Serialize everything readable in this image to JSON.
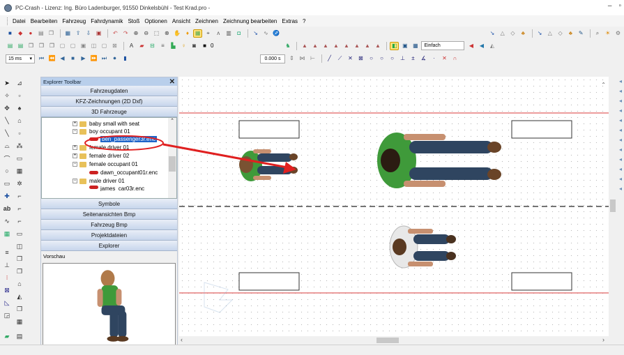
{
  "window": {
    "title": "PC-Crash - Lizenz: Ing. Büro Ladenburger, 91550 Dinkelsbühl - Test Krad.pro -"
  },
  "menu": [
    "Datei",
    "Bearbeiten",
    "Fahrzeug",
    "Fahrdynamik",
    "Stoß",
    "Optionen",
    "Ansicht",
    "Zeichnen",
    "Zeichnung bearbeiten",
    "Extras",
    "?"
  ],
  "toolbar": {
    "time_step": "15 ms",
    "layer_value": "0",
    "time_value": "0.000 s",
    "mode": "Einfach"
  },
  "explorer": {
    "title": "Explorer Toolbar",
    "sections_top": [
      "Fahrzeugdaten",
      "KFZ-Zeichnungen (2D Dxf)",
      "3D Fahrzeuge"
    ],
    "tree": [
      {
        "label": "baby small with seat",
        "type": "folder",
        "expand": "+"
      },
      {
        "label": "boy occupant 01",
        "type": "folder",
        "expand": "−"
      },
      {
        "label": "ben_passenger3r.enc",
        "type": "file",
        "selected": true
      },
      {
        "label": "female driver 01",
        "type": "folder",
        "expand": "+"
      },
      {
        "label": "female driver 02",
        "type": "folder",
        "expand": "+"
      },
      {
        "label": "female occupant 01",
        "type": "folder",
        "expand": "−"
      },
      {
        "label": "dawn_occupant01r.enc",
        "type": "file"
      },
      {
        "label": "male driver 01",
        "type": "folder",
        "expand": "−"
      },
      {
        "label": "james_car03r.enc",
        "type": "file"
      }
    ],
    "sections_bottom": [
      "Symbole",
      "Seitenansichten Bmp",
      "Fahrzeug Bmp",
      "Projektdateien",
      "Explorer"
    ],
    "preview_label": "Vorschau"
  },
  "colors": {
    "accent": "#1e64c8",
    "arrow": "#e02020",
    "lane_red": "#e06060",
    "shirt": "#3f9a3a",
    "jeans": "#2f4560"
  }
}
